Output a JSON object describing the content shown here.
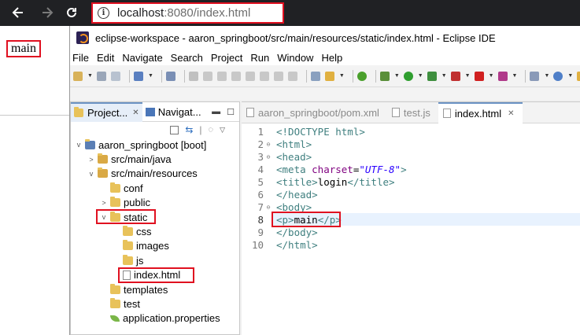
{
  "browser": {
    "url_host": "localhost",
    "url_rest": ":8080/index.html",
    "page_text": "main"
  },
  "eclipse": {
    "window_title": "eclipse-workspace - aaron_springboot/src/main/resources/static/index.html - Eclipse IDE",
    "menu": [
      "File",
      "Edit",
      "Navigate",
      "Search",
      "Project",
      "Run",
      "Window",
      "Help"
    ],
    "explorer": {
      "tabs": [
        "Project...",
        "Navigat..."
      ],
      "tree": [
        {
          "label": "aaron_springboot [boot]",
          "level": 0,
          "expanded": true,
          "icon": "project-icon"
        },
        {
          "label": "src/main/java",
          "level": 1,
          "expanded": false,
          "icon": "source-folder-icon"
        },
        {
          "label": "src/main/resources",
          "level": 1,
          "expanded": true,
          "icon": "source-folder-icon"
        },
        {
          "label": "conf",
          "level": 2,
          "expanded": null,
          "icon": "folder-icon"
        },
        {
          "label": "public",
          "level": 2,
          "expanded": false,
          "icon": "folder-icon"
        },
        {
          "label": "static",
          "level": 2,
          "expanded": true,
          "icon": "folder-icon",
          "highlighted": true
        },
        {
          "label": "css",
          "level": 3,
          "expanded": null,
          "icon": "folder-icon"
        },
        {
          "label": "images",
          "level": 3,
          "expanded": null,
          "icon": "folder-icon"
        },
        {
          "label": "js",
          "level": 3,
          "expanded": null,
          "icon": "folder-icon"
        },
        {
          "label": "index.html",
          "level": 3,
          "expanded": null,
          "icon": "html-file-icon",
          "highlighted": true
        },
        {
          "label": "templates",
          "level": 2,
          "expanded": null,
          "icon": "folder-icon"
        },
        {
          "label": "test",
          "level": 2,
          "expanded": null,
          "icon": "folder-icon"
        },
        {
          "label": "application.properties",
          "level": 2,
          "expanded": null,
          "icon": "properties-file-icon"
        }
      ]
    },
    "editor": {
      "tabs": [
        {
          "label": "aaron_springboot/pom.xml",
          "active": false
        },
        {
          "label": "test.js",
          "active": false
        },
        {
          "label": "index.html",
          "active": true
        }
      ],
      "lines": [
        {
          "n": "1",
          "text": "<!DOCTYPE html>"
        },
        {
          "n": "2",
          "text": "<html>"
        },
        {
          "n": "3",
          "text": "<head>"
        },
        {
          "n": "4",
          "text": "<meta charset=\"UTF-8\">"
        },
        {
          "n": "5",
          "text": "<title>login</title>"
        },
        {
          "n": "6",
          "text": "</head>"
        },
        {
          "n": "7",
          "text": "<body>"
        },
        {
          "n": "8",
          "text": "<p>main</p>"
        },
        {
          "n": "9",
          "text": "</body>"
        },
        {
          "n": "10",
          "text": "</html>"
        }
      ],
      "current_line": "8"
    }
  },
  "colors": {
    "highlight_box": "#e01020",
    "browser_bar": "#202124",
    "tag": "#3f7f7f",
    "attribute": "#7f007f",
    "string": "#2a00ff"
  }
}
